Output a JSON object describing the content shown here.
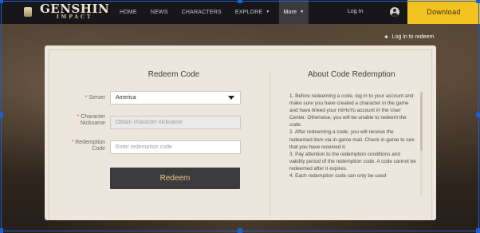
{
  "header": {
    "logo_title": "GENSHIN",
    "logo_subtitle": "IMPACT",
    "nav": [
      {
        "label": "HOME"
      },
      {
        "label": "NEWS"
      },
      {
        "label": "CHARACTERS"
      },
      {
        "label": "EXPLORE",
        "has_caret": true
      },
      {
        "label": "More",
        "has_caret": true,
        "active": true
      }
    ],
    "login_label": "Log In",
    "download_label": "Download"
  },
  "login_redeem": {
    "icon": "star-icon",
    "label": "Log in to redeem"
  },
  "redeem": {
    "title": "Redeem Code",
    "server_label": "Server",
    "server_value": "America",
    "nickname_label_line1": "Character",
    "nickname_label_line2": "Nickname",
    "nickname_placeholder": "Obtain character nickname",
    "code_label_line1": "Redemption",
    "code_label_line2": "Code",
    "code_placeholder": "Enter redemption code",
    "button_label": "Redeem"
  },
  "about": {
    "title": "About Code Redemption",
    "paragraphs": [
      "1. Before redeeming a code, log in to your account and make sure you have created a character in the game and have linked your miHoYo account in the User Center. Otherwise, you will be unable to redeem the code.",
      "2. After redeeming a code, you will receive the redeemed item via in-game mail. Check in-game to see that you have received it.",
      "3. Pay attention to the redemption conditions and validity period of the redemption code. A code cannot be redeemed after it expires.",
      "4. Each redemption code can only be used"
    ]
  },
  "colors": {
    "topbar": "#17171a",
    "download": "#f3c322",
    "card": "#ece6dc",
    "button": "#3b3b3d",
    "button_text": "#e4c689",
    "required": "#d64b3c"
  }
}
